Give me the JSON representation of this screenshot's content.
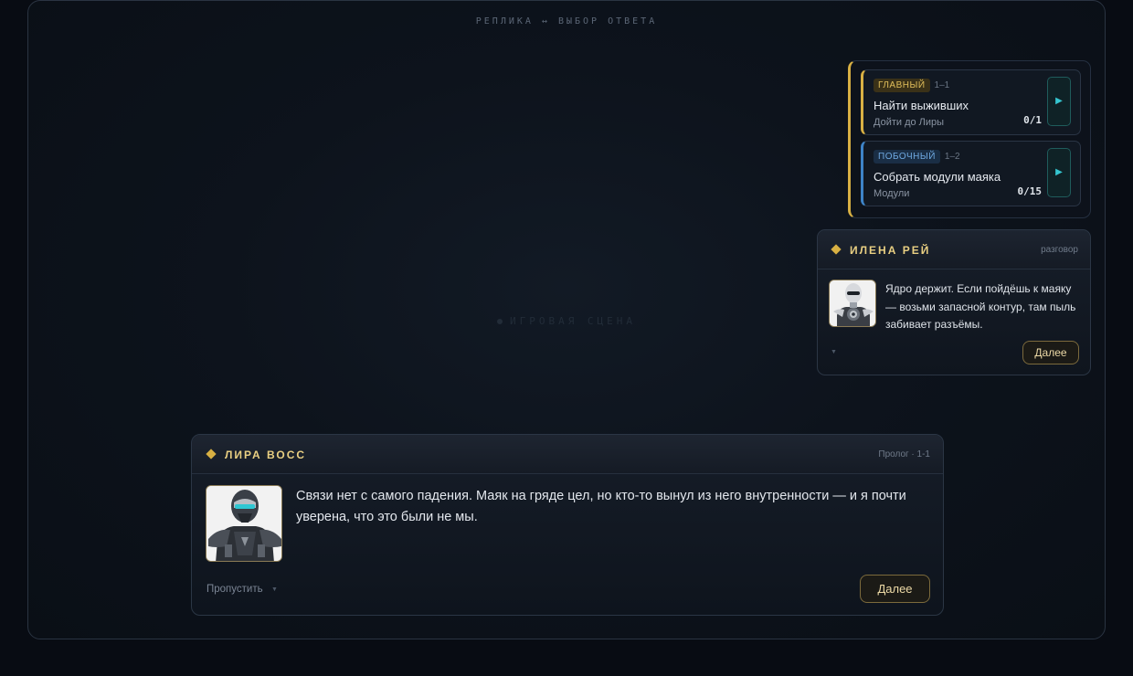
{
  "header": {
    "label": "РЕПЛИКА ↔ ВЫБОР ОТВЕТА"
  },
  "scene": {
    "label": "ИГРОВАЯ СЦЕНА"
  },
  "quests": [
    {
      "tag": "ГЛАВНЫЙ",
      "num": "1–1",
      "title": "Найти выживших",
      "sub": "Дойти до Лиры",
      "count": "0/1",
      "accent": "#d8b043"
    },
    {
      "tag": "ПОБОЧНЫЙ",
      "num": "1–2",
      "title": "Собрать модули маяка",
      "sub": "Модули",
      "count": "0/15",
      "accent": "#3e84c8"
    }
  ],
  "npc_dialog": {
    "name": "ИЛЕНА РЕЙ",
    "tag": "разговор",
    "text": "Ядро держит. Если пойдёшь к маяку — возьми запасной контур, там пыль забивает разъёмы.",
    "next_label": "Далее"
  },
  "main_dialog": {
    "name": "ЛИРА ВОСС",
    "tag": "Пролог · 1-1",
    "text": "Связи нет с самого падения. Маяк на гряде цел, но кто-то вынул из него внутренности — и я почти уверена, что это были не мы.",
    "skip_label": "Пропустить",
    "next_label": "Далее"
  },
  "colors": {
    "accent_gold": "#d8b043",
    "accent_blue": "#3e84c8",
    "accent_cyan": "#35c6d0"
  },
  "icons": {
    "quest_play": "play-icon",
    "speaker": "diamond-icon"
  }
}
